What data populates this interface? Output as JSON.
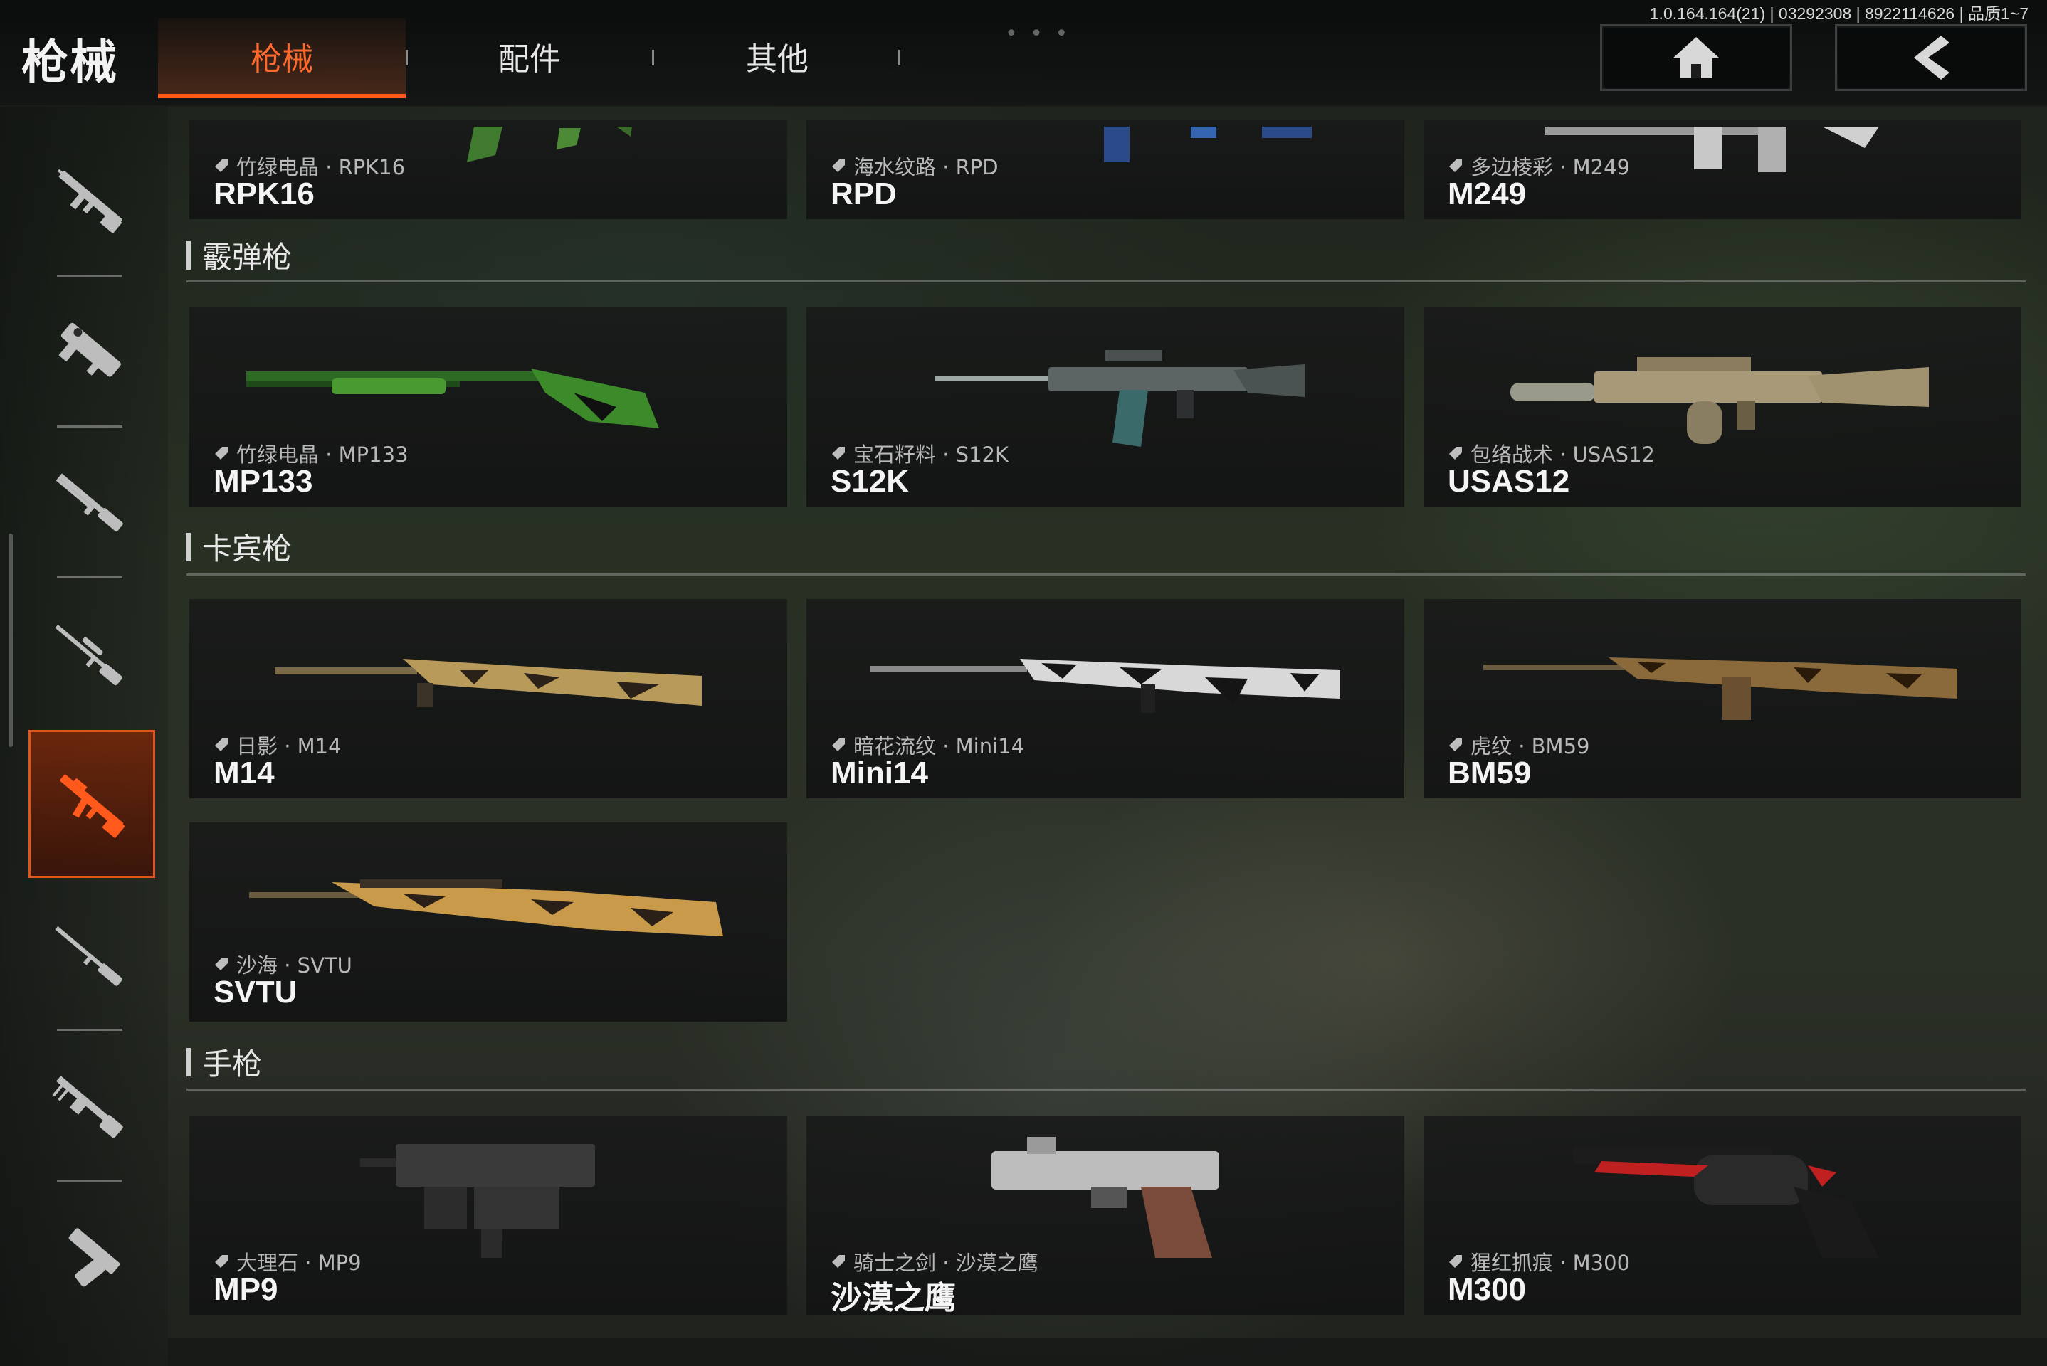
{
  "header": {
    "title": "枪械",
    "tabs": [
      {
        "label": "枪械",
        "active": true
      },
      {
        "label": "配件",
        "active": false
      },
      {
        "label": "其他",
        "active": false
      }
    ],
    "version": "1.0.164.164(21) | 03292308 | 8922114626 | 品质1~7",
    "home_icon": "home-icon",
    "back_icon": "chevron-left-icon",
    "drag_dots": "• • •"
  },
  "colors": {
    "accent": "#ff5a1c",
    "card_bg": "#181919",
    "text": "#f4f4f4",
    "muted": "#b8b8b8"
  },
  "rail": {
    "items": [
      {
        "icon": "assault-rifle-icon",
        "active": false
      },
      {
        "icon": "smg-icon",
        "active": false
      },
      {
        "icon": "shotgun-icon",
        "active": false
      },
      {
        "icon": "sniper-rifle-icon",
        "active": false
      },
      {
        "icon": "carbine-icon",
        "active": true
      },
      {
        "icon": "marksman-rifle-icon",
        "active": false
      },
      {
        "icon": "lmg-icon",
        "active": false
      },
      {
        "icon": "pistol-icon",
        "active": false
      }
    ]
  },
  "top_row": [
    {
      "skin": "竹绿电晶 · RPK16",
      "name": "RPK16"
    },
    {
      "skin": "海水纹路 · RPD",
      "name": "RPD"
    },
    {
      "skin": "多边棱彩 · M249",
      "name": "M249"
    }
  ],
  "sections": [
    {
      "title": "霰弹枪",
      "cards": [
        {
          "skin": "竹绿电晶 · MP133",
          "name": "MP133"
        },
        {
          "skin": "宝石籽料 · S12K",
          "name": "S12K"
        },
        {
          "skin": "包络战术 · USAS12",
          "name": "USAS12"
        }
      ]
    },
    {
      "title": "卡宾枪",
      "cards": [
        {
          "skin": "日影 · M14",
          "name": "M14"
        },
        {
          "skin": "暗花流纹 · Mini14",
          "name": "Mini14"
        },
        {
          "skin": "虎纹 · BM59",
          "name": "BM59"
        },
        {
          "skin": "沙海 · SVTU",
          "name": "SVTU"
        }
      ]
    },
    {
      "title": "手枪",
      "cards": [
        {
          "skin": "大理石 · MP9",
          "name": "MP9"
        },
        {
          "skin": "骑士之剑 · 沙漠之鹰",
          "name": "沙漠之鹰"
        },
        {
          "skin": "猩红抓痕 · M300",
          "name": "M300"
        }
      ]
    }
  ]
}
